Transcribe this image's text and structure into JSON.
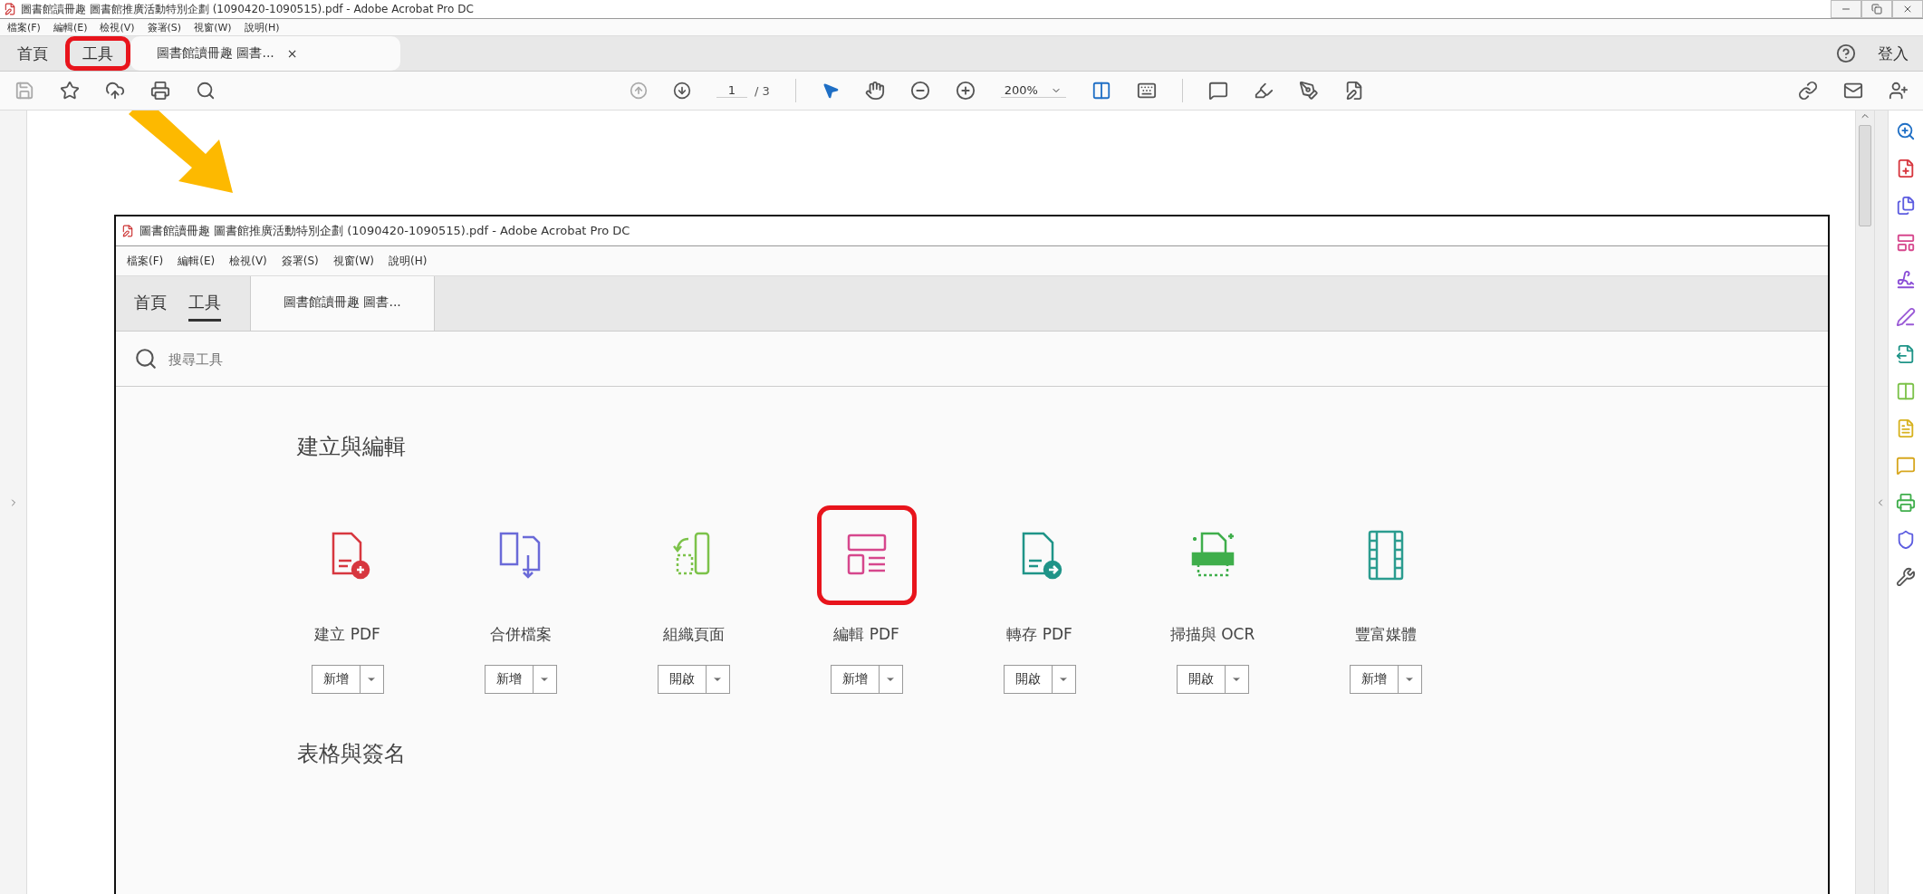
{
  "window": {
    "title": "圖書館讀冊趣 圖書館推廣活動特別企劃 (1090420-1090515).pdf - Adobe Acrobat Pro DC"
  },
  "menu": [
    "檔案(F)",
    "編輯(E)",
    "檢視(V)",
    "簽署(S)",
    "視窗(W)",
    "說明(H)"
  ],
  "tabs": [
    {
      "label": "首頁",
      "selected": false,
      "highlighted": false
    },
    {
      "label": "工具",
      "selected": false,
      "highlighted": true
    },
    {
      "label": "圖書館讀冊趣 圖書...",
      "selected": true,
      "highlighted": false,
      "close": "×"
    }
  ],
  "sign_in": "登入",
  "toolbar": {
    "page": "1",
    "page_total": "/ 3",
    "zoom": "200%"
  },
  "document": {
    "window": {
      "title": "圖書館讀冊趣 圖書館推廣活動特別企劃 (1090420-1090515).pdf - Adobe Acrobat Pro DC"
    },
    "menu": [
      "檔案(F)",
      "編輯(E)",
      "檢視(V)",
      "簽署(S)",
      "視窗(W)",
      "說明(H)"
    ],
    "tabs": [
      {
        "label": "首頁",
        "selected": false
      },
      {
        "label": "工具",
        "selected": true
      },
      {
        "label": "圖書館讀冊趣 圖書...",
        "selected": false
      }
    ],
    "search": {
      "placeholder": "搜尋工具"
    },
    "sections": [
      {
        "title": "建立與編輯",
        "tools": [
          {
            "label": "建立 PDF",
            "action": "新增",
            "kind": "create",
            "color": "#d7373f",
            "highlighted": false
          },
          {
            "label": "合併檔案",
            "action": "新增",
            "kind": "combine",
            "color": "#6a6ad8",
            "highlighted": false
          },
          {
            "label": "組織頁面",
            "action": "開啟",
            "kind": "organize",
            "color": "#7cc24a",
            "highlighted": false
          },
          {
            "label": "編輯 PDF",
            "action": "新增",
            "kind": "edit",
            "color": "#d6478d",
            "highlighted": true
          },
          {
            "label": "轉存 PDF",
            "action": "開啟",
            "kind": "export",
            "color": "#1f9488",
            "highlighted": false
          },
          {
            "label": "掃描與 OCR",
            "action": "開啟",
            "kind": "scan",
            "color": "#3fae4b",
            "highlighted": false
          },
          {
            "label": "豐富媒體",
            "action": "新增",
            "kind": "media",
            "color": "#2b9c8f",
            "highlighted": false
          }
        ]
      },
      {
        "title": "表格與簽名"
      }
    ]
  }
}
